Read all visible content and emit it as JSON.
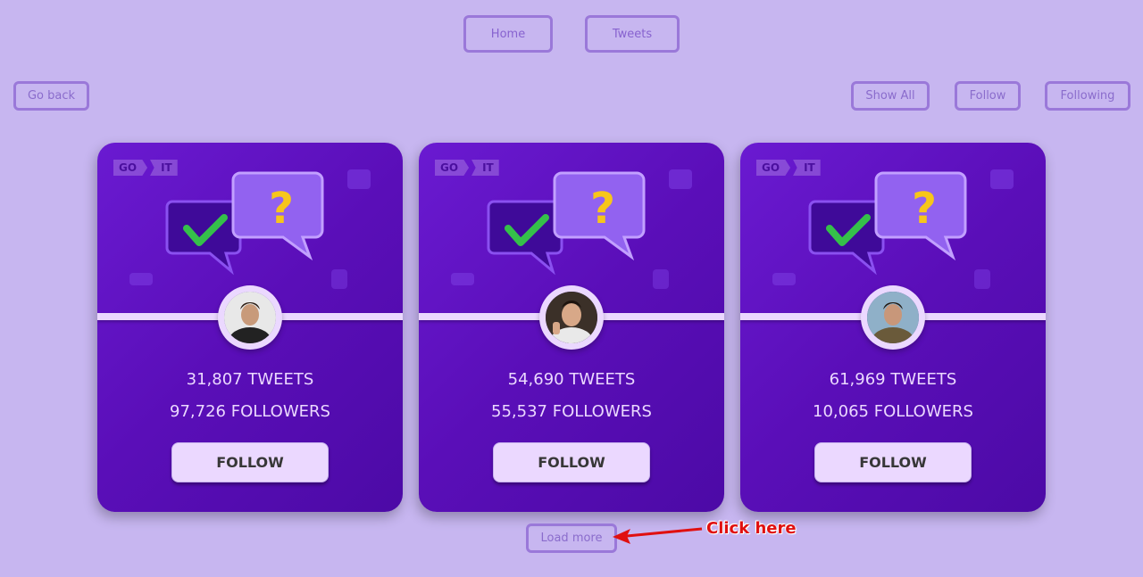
{
  "nav": {
    "home_label": "Home",
    "tweets_label": "Tweets"
  },
  "toolbar": {
    "go_back_label": "Go back",
    "show_all_label": "Show All",
    "follow_label": "Follow",
    "following_label": "Following"
  },
  "cards": [
    {
      "logo_go": "GO",
      "logo_it": "IT",
      "tweets": "31,807 TWEETS",
      "followers": "97,726 FOLLOWERS",
      "button": "FOLLOW"
    },
    {
      "logo_go": "GO",
      "logo_it": "IT",
      "tweets": "54,690 TWEETS",
      "followers": "55,537 FOLLOWERS",
      "button": "FOLLOW"
    },
    {
      "logo_go": "GO",
      "logo_it": "IT",
      "tweets": "61,969 TWEETS",
      "followers": "10,065 FOLLOWERS",
      "button": "FOLLOW"
    }
  ],
  "load_more_label": "Load more",
  "annotation_text": "Click here",
  "colors": {
    "background": "#c7b6f0",
    "card": "#5a0eb8",
    "accent": "#ebd8ff",
    "annotation": "#e01010"
  }
}
